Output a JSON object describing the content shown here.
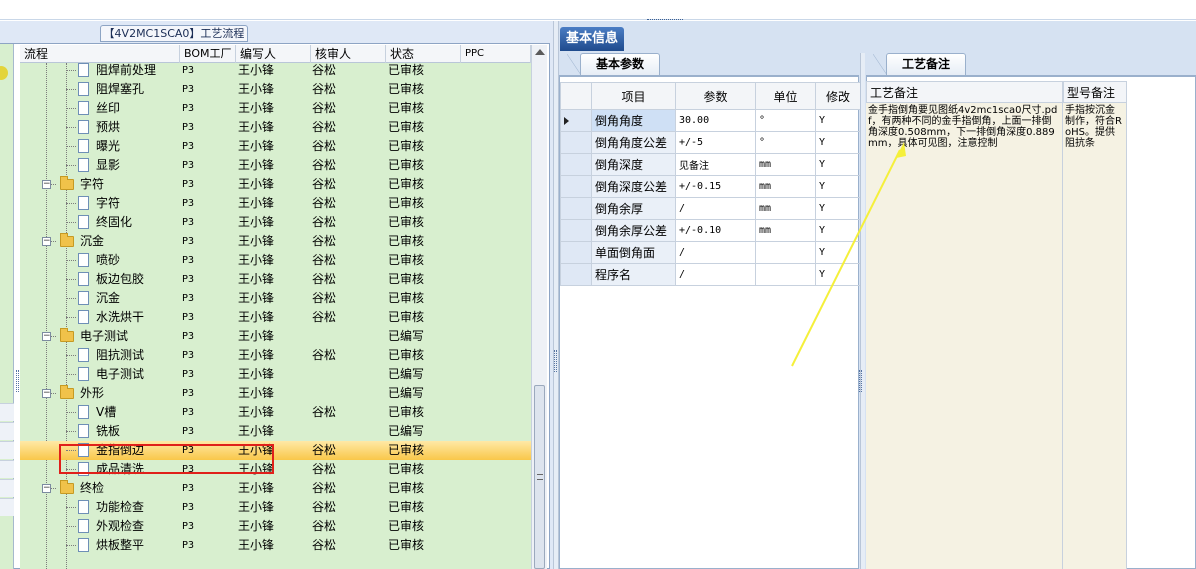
{
  "left_panel": {
    "title_tab": "【4V2MC1SCA0】工艺流程",
    "columns": [
      "流程",
      "BOM工厂",
      "编写人",
      "核审人",
      "状态",
      "PPC"
    ],
    "rows": [
      {
        "kind": "doc",
        "level": 2,
        "name": "阻焊前处理",
        "plant": "P3",
        "writer": "王小锋",
        "reviewer": "谷松",
        "status": "已审核"
      },
      {
        "kind": "doc",
        "level": 2,
        "name": "阻焊塞孔",
        "plant": "P3",
        "writer": "王小锋",
        "reviewer": "谷松",
        "status": "已审核"
      },
      {
        "kind": "doc",
        "level": 2,
        "name": "丝印",
        "plant": "P3",
        "writer": "王小锋",
        "reviewer": "谷松",
        "status": "已审核"
      },
      {
        "kind": "doc",
        "level": 2,
        "name": "预烘",
        "plant": "P3",
        "writer": "王小锋",
        "reviewer": "谷松",
        "status": "已审核"
      },
      {
        "kind": "doc",
        "level": 2,
        "name": "曝光",
        "plant": "P3",
        "writer": "王小锋",
        "reviewer": "谷松",
        "status": "已审核"
      },
      {
        "kind": "doc",
        "level": 2,
        "name": "显影",
        "plant": "P3",
        "writer": "王小锋",
        "reviewer": "谷松",
        "status": "已审核"
      },
      {
        "kind": "folder",
        "level": 1,
        "name": "字符",
        "plant": "P3",
        "writer": "王小锋",
        "reviewer": "谷松",
        "status": "已审核"
      },
      {
        "kind": "doc",
        "level": 2,
        "name": "字符",
        "plant": "P3",
        "writer": "王小锋",
        "reviewer": "谷松",
        "status": "已审核"
      },
      {
        "kind": "doc",
        "level": 2,
        "name": "终固化",
        "plant": "P3",
        "writer": "王小锋",
        "reviewer": "谷松",
        "status": "已审核"
      },
      {
        "kind": "folder",
        "level": 1,
        "name": "沉金",
        "plant": "P3",
        "writer": "王小锋",
        "reviewer": "谷松",
        "status": "已审核"
      },
      {
        "kind": "doc",
        "level": 2,
        "name": "喷砂",
        "plant": "P3",
        "writer": "王小锋",
        "reviewer": "谷松",
        "status": "已审核"
      },
      {
        "kind": "doc",
        "level": 2,
        "name": "板边包胶",
        "plant": "P3",
        "writer": "王小锋",
        "reviewer": "谷松",
        "status": "已审核"
      },
      {
        "kind": "doc",
        "level": 2,
        "name": "沉金",
        "plant": "P3",
        "writer": "王小锋",
        "reviewer": "谷松",
        "status": "已审核"
      },
      {
        "kind": "doc",
        "level": 2,
        "name": "水洗烘干",
        "plant": "P3",
        "writer": "王小锋",
        "reviewer": "谷松",
        "status": "已审核"
      },
      {
        "kind": "folder",
        "level": 1,
        "name": "电子测试",
        "plant": "P3",
        "writer": "王小锋",
        "reviewer": "",
        "status": "已编写"
      },
      {
        "kind": "doc",
        "level": 2,
        "name": "阻抗测试",
        "plant": "P3",
        "writer": "王小锋",
        "reviewer": "谷松",
        "status": "已审核"
      },
      {
        "kind": "doc",
        "level": 2,
        "name": "电子测试",
        "plant": "P3",
        "writer": "王小锋",
        "reviewer": "",
        "status": "已编写"
      },
      {
        "kind": "folder",
        "level": 1,
        "name": "外形",
        "plant": "P3",
        "writer": "王小锋",
        "reviewer": "",
        "status": "已编写"
      },
      {
        "kind": "doc",
        "level": 2,
        "name": "V槽",
        "plant": "P3",
        "writer": "王小锋",
        "reviewer": "谷松",
        "status": "已审核"
      },
      {
        "kind": "doc",
        "level": 2,
        "name": "铣板",
        "plant": "P3",
        "writer": "王小锋",
        "reviewer": "",
        "status": "已编写"
      },
      {
        "kind": "doc",
        "level": 2,
        "name": "金指倒边",
        "plant": "P3",
        "writer": "王小锋",
        "reviewer": "谷松",
        "status": "已审核",
        "selected": true
      },
      {
        "kind": "doc",
        "level": 2,
        "name": "成品清洗",
        "plant": "P3",
        "writer": "王小锋",
        "reviewer": "谷松",
        "status": "已审核"
      },
      {
        "kind": "folder",
        "level": 1,
        "name": "终检",
        "plant": "P3",
        "writer": "王小锋",
        "reviewer": "谷松",
        "status": "已审核"
      },
      {
        "kind": "doc",
        "level": 2,
        "name": "功能检查",
        "plant": "P3",
        "writer": "王小锋",
        "reviewer": "谷松",
        "status": "已审核"
      },
      {
        "kind": "doc",
        "level": 2,
        "name": "外观检查",
        "plant": "P3",
        "writer": "王小锋",
        "reviewer": "谷松",
        "status": "已审核"
      },
      {
        "kind": "doc",
        "level": 2,
        "name": "烘板整平",
        "plant": "P3",
        "writer": "王小锋",
        "reviewer": "谷松",
        "status": "已审核"
      }
    ]
  },
  "right_panel": {
    "main_tab": "基本信息",
    "params_tab": "基本参数",
    "notes_tab": "工艺备注",
    "grid_columns": [
      "项目",
      "参数",
      "单位",
      "修改"
    ],
    "grid_rows": [
      {
        "item": "倒角角度",
        "value": "30.00",
        "unit": "°",
        "edit": "Y",
        "active": true
      },
      {
        "item": "倒角角度公差",
        "value": "+/-5",
        "unit": "°",
        "edit": "Y"
      },
      {
        "item": "倒角深度",
        "value": "见备注",
        "unit": "mm",
        "edit": "Y"
      },
      {
        "item": "倒角深度公差",
        "value": "+/-0.15",
        "unit": "mm",
        "edit": "Y"
      },
      {
        "item": "倒角余厚",
        "value": "/",
        "unit": "mm",
        "edit": "Y"
      },
      {
        "item": "倒角余厚公差",
        "value": "+/-0.10",
        "unit": "mm",
        "edit": "Y"
      },
      {
        "item": "单面倒角面",
        "value": "/",
        "unit": "",
        "edit": "Y"
      },
      {
        "item": "程序名",
        "value": "/",
        "unit": "",
        "edit": "Y"
      }
    ],
    "notes": {
      "process_header": "工艺备注",
      "model_header": "型号备注",
      "process_text": "金手指倒角要见图纸4v2mc1sca0尺寸.pdf，有两种不同的金手指倒角，上面一排倒角深度0.508mm，下一排倒角深度0.889mm，具体可见图，注意控制",
      "model_text": "手指按沉金制作，符合RoHS。提供阻抗条"
    }
  },
  "colors": {
    "tree_bg": "#d8efcf",
    "selection": "#f9c74a",
    "highlight_box": "#e0201a",
    "annotation_arrow": "#f5f03a",
    "tab_active": "#1f4b8d"
  }
}
